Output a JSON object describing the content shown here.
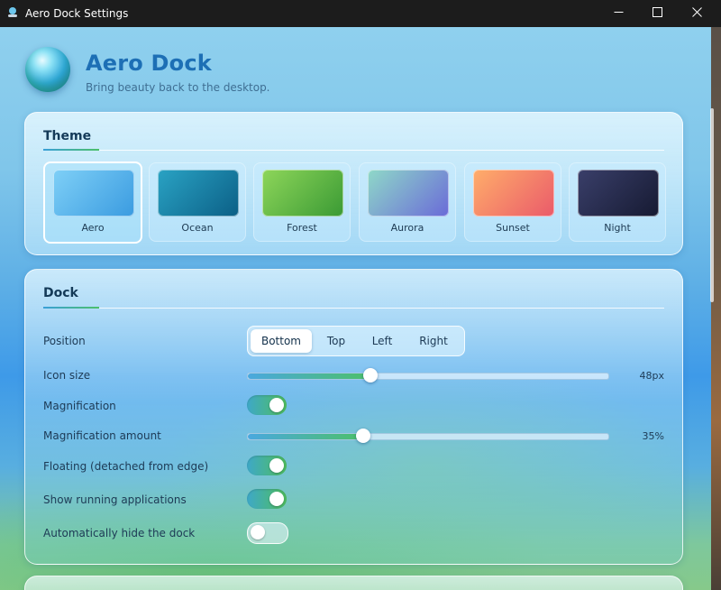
{
  "window": {
    "title": "Aero Dock Settings",
    "controls": {
      "minimize_icon": "minimize-icon",
      "maximize_icon": "maximize-icon",
      "close_icon": "close-icon"
    }
  },
  "header": {
    "title": "Aero Dock",
    "subtitle": "Bring beauty back to the desktop.",
    "logo_icon": "globe-orb-icon"
  },
  "theme_section": {
    "title": "Theme",
    "selected": "Aero",
    "themes": [
      {
        "label": "Aero",
        "colors": [
          "#7fd0f7",
          "#3a9be0"
        ]
      },
      {
        "label": "Ocean",
        "colors": [
          "#2aa3c4",
          "#0b5f86"
        ]
      },
      {
        "label": "Forest",
        "colors": [
          "#8ed65a",
          "#3a9a34"
        ]
      },
      {
        "label": "Aurora",
        "colors": [
          "#8fd9c8",
          "#6a6ad8"
        ]
      },
      {
        "label": "Sunset",
        "colors": [
          "#ffae6a",
          "#ea5a6a"
        ]
      },
      {
        "label": "Night",
        "colors": [
          "#3a3f6a",
          "#161a32"
        ]
      }
    ]
  },
  "dock_section": {
    "title": "Dock",
    "position": {
      "label": "Position",
      "options": [
        "Bottom",
        "Top",
        "Left",
        "Right"
      ],
      "selected": "Bottom"
    },
    "icon_size": {
      "label": "Icon size",
      "value_text": "48px",
      "fraction": 0.34
    },
    "magnification": {
      "label": "Magnification",
      "on": true
    },
    "magnification_amount": {
      "label": "Magnification amount",
      "value_text": "35%",
      "fraction": 0.32
    },
    "floating": {
      "label": "Floating (detached from edge)",
      "on": true
    },
    "show_running": {
      "label": "Show running applications",
      "on": true
    },
    "auto_hide": {
      "label": "Automatically hide the dock",
      "on": false
    }
  },
  "colors": {
    "accent_blue": "#1d6fb5",
    "toggle_on": "#4fbf5e"
  }
}
